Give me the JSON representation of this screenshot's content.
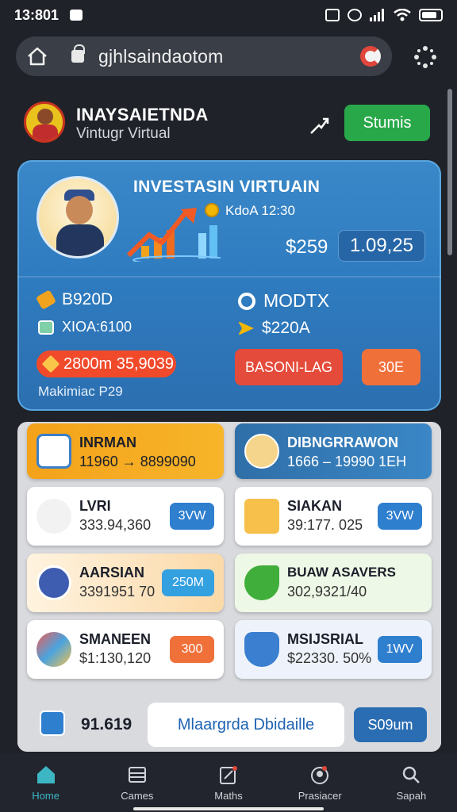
{
  "status_bar": {
    "time": "13:801"
  },
  "browser": {
    "url": "gjhlsaindaotom"
  },
  "header": {
    "brand": "INAYSAIETNDA",
    "subtitle": "Vintugr Virtual",
    "action_label": "Stumis",
    "colors": {
      "action": "#29a84a"
    }
  },
  "hero": {
    "title": "INVESTASIN VIRTUAIN",
    "ticker": "KdoA 12:30",
    "value_main": "$259",
    "value_box": "1.09,25",
    "stat_left_1": "B920D",
    "stat_left_2": "XIOA:6100",
    "stat_right_1": "MODTX",
    "stat_right_2": "$220A",
    "pill_text": "2800m 35,9039",
    "footer_text": "Makimiac P29",
    "btn_red_label": "BASONI-LAG",
    "btn_orange_label": "30E",
    "colors": {
      "accent_red": "#e54b3a",
      "accent_orange": "#f0703a",
      "card_blue": "#2f7cc0"
    }
  },
  "grid": {
    "featured_left": {
      "title": "INRMAN",
      "value": "11960 → 8899090"
    },
    "featured_right": {
      "title": "DIBNGRRAWON",
      "value": "1666 – 19990 1EH"
    },
    "cards": [
      {
        "title": "LVRI",
        "value": "333.94,360",
        "button": "3VW"
      },
      {
        "title": "SIAKAN",
        "value": "39:177. 025",
        "button": "3VW"
      },
      {
        "title": "AARSIAN",
        "value": "3391951 70",
        "button": "250M"
      },
      {
        "title": "BUAW ASAVERS",
        "value": "302,9321/40",
        "button": ""
      },
      {
        "title": "SMANEEN",
        "value": "$1:130,120",
        "button": "300"
      },
      {
        "title": "MSIJSRIAL",
        "value": "$22330. 50%",
        "button": "1WV"
      }
    ]
  },
  "bottom_strip": {
    "value": "91.619",
    "input_text": "Mlaargrda Dbidaille",
    "button": "S09um"
  },
  "nav": {
    "items": [
      {
        "label": "Home",
        "icon": "home-icon"
      },
      {
        "label": "Cames",
        "icon": "games-icon"
      },
      {
        "label": "Maths",
        "icon": "edit-icon"
      },
      {
        "label": "Prasiacer",
        "icon": "user-icon"
      },
      {
        "label": "Sapah",
        "icon": "search-icon"
      }
    ]
  }
}
